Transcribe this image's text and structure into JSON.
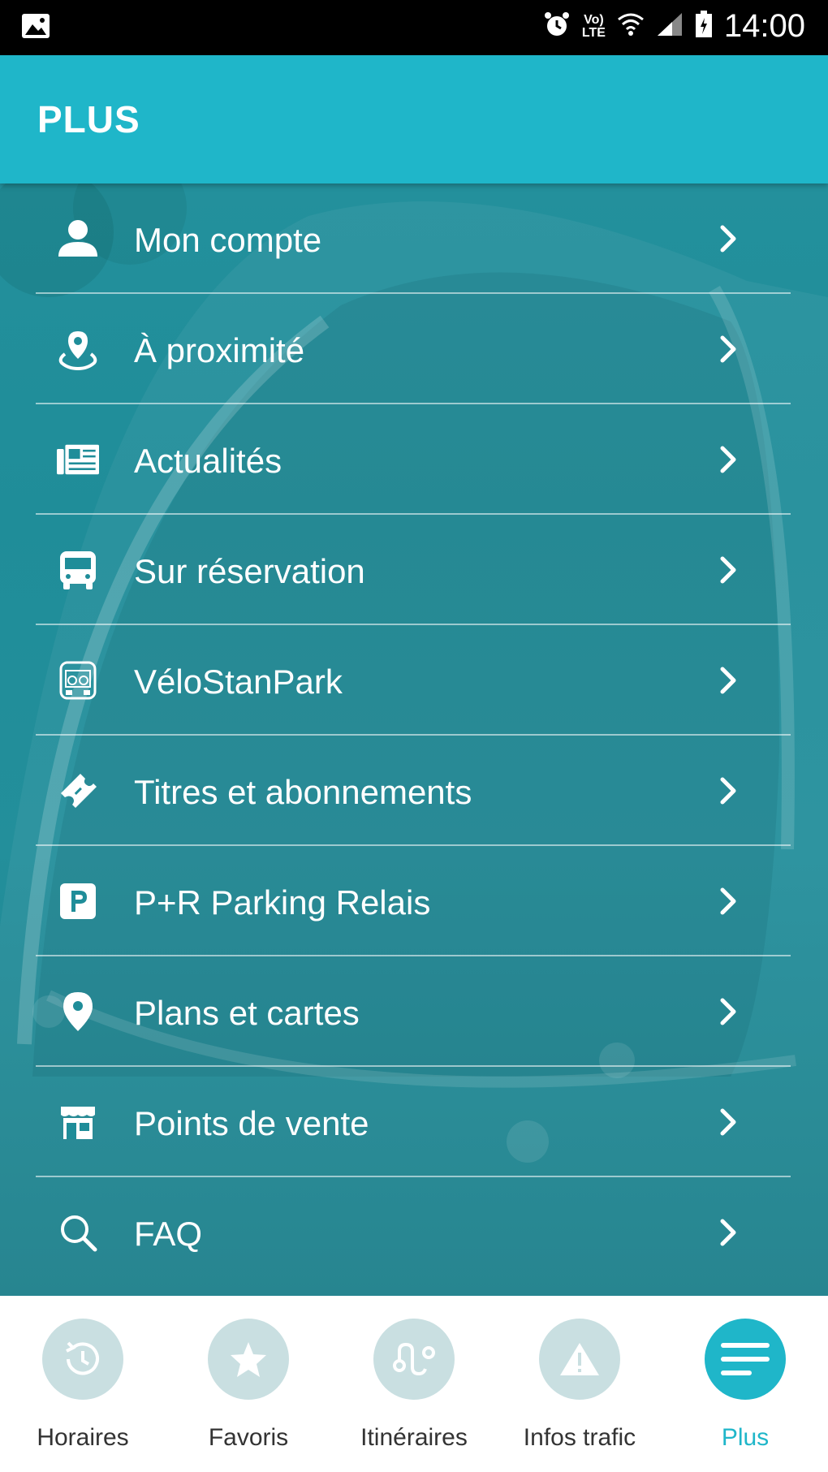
{
  "status_bar": {
    "time": "14:00",
    "network": "LTE"
  },
  "app_bar": {
    "title": "PLUS"
  },
  "menu": [
    {
      "label": "Mon compte",
      "icon": "person-icon"
    },
    {
      "label": "À proximité",
      "icon": "location-pin-icon"
    },
    {
      "label": "Actualités",
      "icon": "newspaper-icon"
    },
    {
      "label": "Sur réservation",
      "icon": "bus-icon"
    },
    {
      "label": "VéloStanPark",
      "icon": "bike-parking-icon"
    },
    {
      "label": "Titres et abonnements",
      "icon": "ticket-icon"
    },
    {
      "label": "P+R Parking Relais",
      "icon": "parking-icon"
    },
    {
      "label": "Plans et cartes",
      "icon": "map-pin-icon"
    },
    {
      "label": "Points de vente",
      "icon": "store-icon"
    },
    {
      "label": "FAQ",
      "icon": "search-icon"
    }
  ],
  "bottom_nav": [
    {
      "label": "Horaires",
      "icon": "clock-icon",
      "active": false
    },
    {
      "label": "Favoris",
      "icon": "star-icon",
      "active": false
    },
    {
      "label": "Itinéraires",
      "icon": "route-icon",
      "active": false
    },
    {
      "label": "Infos trafic",
      "icon": "warning-icon",
      "active": false
    },
    {
      "label": "Plus",
      "icon": "menu-lines-icon",
      "active": true
    }
  ],
  "colors": {
    "primary": "#1fb6c9",
    "background": "#1f8d99",
    "nav_inactive": "#c9dfe1"
  }
}
